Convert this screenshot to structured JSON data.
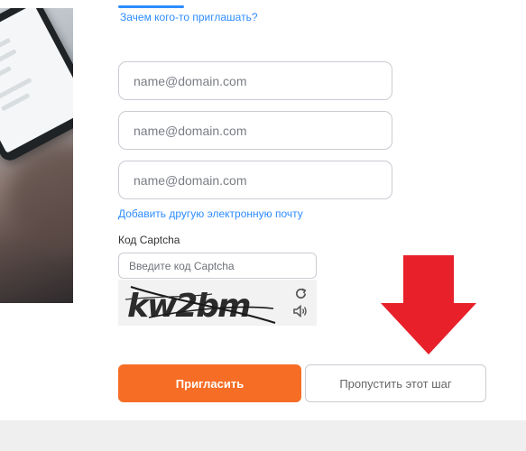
{
  "header": {
    "why_invite_link": "Зачем кого-то приглашать?"
  },
  "emails": [
    {
      "placeholder": "name@domain.com",
      "value": ""
    },
    {
      "placeholder": "name@domain.com",
      "value": ""
    },
    {
      "placeholder": "name@domain.com",
      "value": ""
    }
  ],
  "add_email_link": "Добавить другую электронную почту",
  "captcha": {
    "label": "Код Captcha",
    "placeholder": "Введите код Captcha",
    "image_text": "kw2bm",
    "refresh_icon": "refresh-icon",
    "audio_icon": "speaker-icon"
  },
  "annotation": {
    "arrow_color": "#e8202a"
  },
  "buttons": {
    "invite_label": "Пригласить",
    "skip_label": "Пропустить этот шаг"
  },
  "colors": {
    "accent": "#2d8cff",
    "primary_button": "#f66d25"
  }
}
